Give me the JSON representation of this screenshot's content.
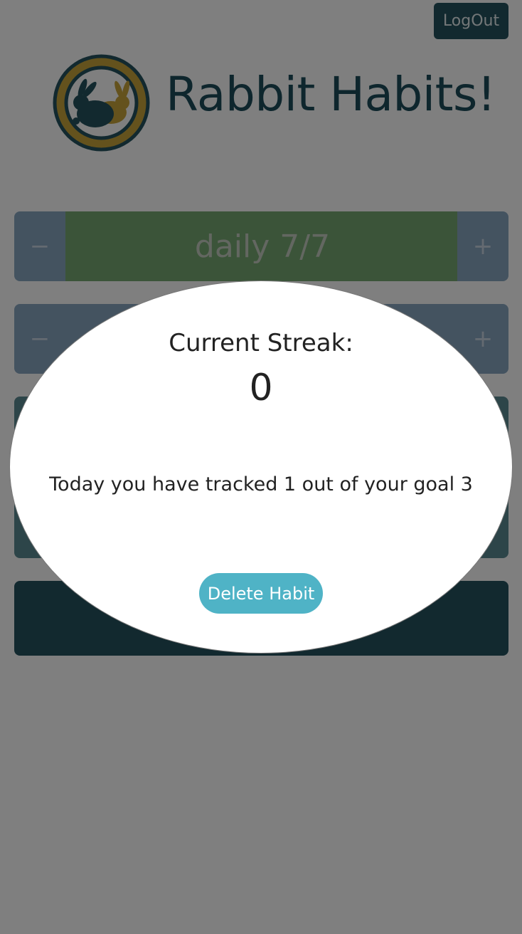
{
  "header": {
    "logout_label": "LogOut",
    "app_title": "Rabbit Habits!"
  },
  "habits": [
    {
      "minus": "−",
      "label": "daily 7/7",
      "plus": "+"
    },
    {
      "minus": "−",
      "label": "",
      "plus": "+"
    }
  ],
  "modal": {
    "streak_label": "Current Streak:",
    "streak_value": "0",
    "tracked_text": "Today you have tracked 1 out of your goal 3",
    "delete_label": "Delete Habit"
  },
  "colors": {
    "brand_dark": "#24535e",
    "brand_gold": "#c9a43a",
    "accent": "#4fb3c6",
    "success": "#77a873"
  }
}
